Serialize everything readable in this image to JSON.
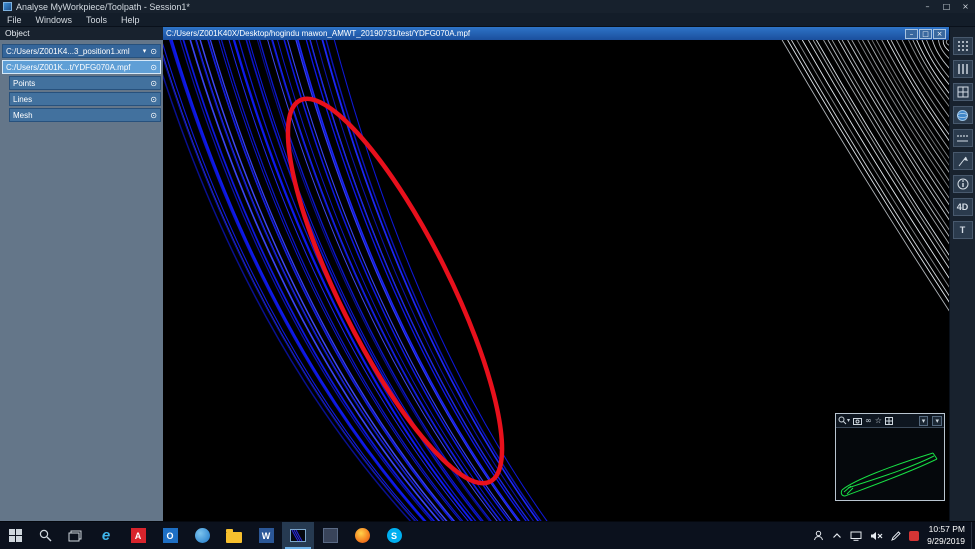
{
  "window": {
    "title": "Analyse MyWorkpiece/Toolpath - Session1*",
    "menus": [
      "File",
      "Windows",
      "Tools",
      "Help"
    ]
  },
  "icons": {
    "minimize": "–",
    "maximize": "□",
    "close": "×",
    "chevron_down": "▾",
    "eye": "⊙",
    "infinity": "∞",
    "star": "☆",
    "dropdown": "▾"
  },
  "object_panel": {
    "header": "Object",
    "items": [
      {
        "label": "C:/Users/Z001K4...3_position1.xml"
      },
      {
        "label": "C:/Users/Z001K...t/YDFG070A.mpf"
      },
      {
        "label": "Points"
      },
      {
        "label": "Lines"
      },
      {
        "label": "Mesh"
      }
    ]
  },
  "viewport": {
    "title": "C:/Users/Z001K40X/Desktop/hogindu mawon_AMWT_20190731/test/YDFG070A.mpf"
  },
  "right_toolbar": {
    "label_4d": "4D",
    "label_t": "T"
  },
  "taskbar": {
    "ie_label": "e",
    "red_app_label": "A",
    "mail_app_label": "O",
    "word_label": "W",
    "skype_label": "S"
  },
  "tray": {
    "time": "10:57 PM",
    "date": "9/29/2019"
  },
  "scene": {
    "toolpath": {
      "count": 48,
      "hue": 237
    },
    "fan_lines": {
      "count": 34,
      "color": "#e3e9ef",
      "slope": 1.62
    },
    "annotation": {
      "color": "#e8101c"
    },
    "navigator": {
      "outline_color": "#18df45"
    }
  }
}
